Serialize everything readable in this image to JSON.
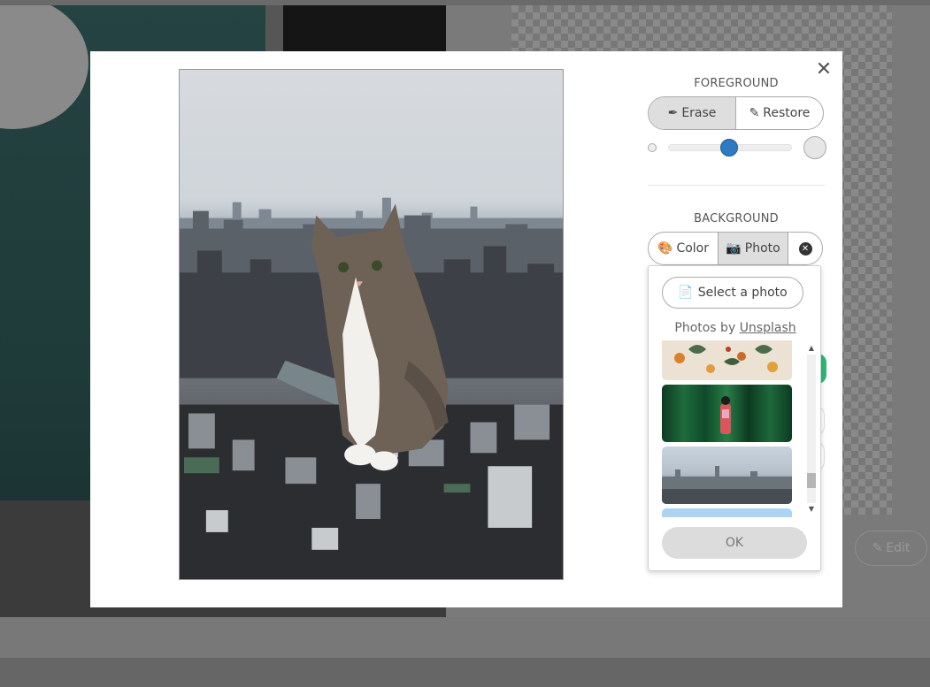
{
  "background_page": {
    "edit_label": "Edit",
    "edit_icon": "pencil-icon"
  },
  "modal": {
    "close_icon": "close-icon",
    "preview_alt": "Cat cutout over city skyline background",
    "foreground": {
      "title": "FOREGROUND",
      "erase_label": "Erase",
      "erase_icon": "eraser-icon",
      "restore_label": "Restore",
      "restore_icon": "pencil-icon",
      "active": "Erase",
      "brush_size_fraction": 0.49
    },
    "background": {
      "title": "BACKGROUND",
      "color_label": "Color",
      "color_icon": "palette-icon",
      "photo_label": "Photo",
      "photo_icon": "camera-icon",
      "remove_icon": "remove-circle-icon",
      "active": "Photo"
    },
    "photo_popup": {
      "select_label": "Select a photo",
      "select_icon": "file-upload-icon",
      "photos_by": "Photos by",
      "unsplash": "Unsplash",
      "thumbnails": [
        "flowers-pattern",
        "bamboo-forest-kimono",
        "city-skyline",
        "blue-sky"
      ],
      "ok_label": "OK"
    }
  },
  "colors": {
    "accent_blue": "#2f7ac0",
    "green": "#2fb779",
    "active_segment": "#dedede"
  }
}
